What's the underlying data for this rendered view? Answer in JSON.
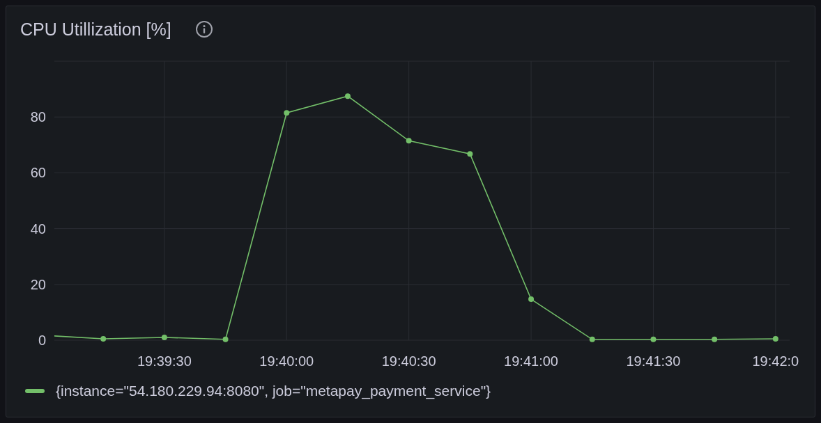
{
  "panel": {
    "title": "CPU Utillization [%]",
    "chart_data": {
      "type": "line",
      "categories": [
        null,
        null,
        "19:39:30",
        null,
        "19:40:00",
        null,
        "19:40:30",
        null,
        "19:41:00",
        null,
        "19:41:30",
        null,
        "19:42:0"
      ],
      "series": [
        {
          "name": "{instance=\"54.180.229.94:8080\", job=\"metapay_payment_service\"}",
          "color": "#73bf69",
          "marker": "circle",
          "values": [
            1.8,
            0.5,
            1,
            0.3,
            81.5,
            87.5,
            71.5,
            66.8,
            14.7,
            0.3,
            0.3,
            0.3,
            0.5
          ]
        }
      ],
      "ylim": [
        0,
        100
      ],
      "grid": true,
      "yticks": [
        0,
        20,
        40,
        60,
        80
      ]
    }
  }
}
